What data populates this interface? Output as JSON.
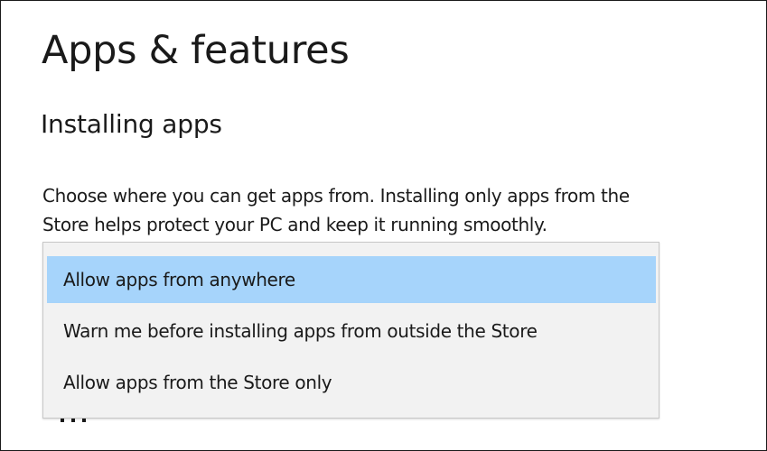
{
  "page": {
    "title": "Apps & features"
  },
  "section": {
    "heading": "Installing apps",
    "description_line1": "Choose where you can get apps from. Installing only apps from the",
    "description_line2": "Store helps protect your PC and keep it running smoothly."
  },
  "dropdown": {
    "selected_index": 0,
    "highlight_color": "#a6d4fb",
    "list_background": "#f2f2f2",
    "options": [
      {
        "label": "Allow apps from anywhere"
      },
      {
        "label": "Warn me before installing apps from outside the Store"
      },
      {
        "label": "Allow apps from the Store only"
      }
    ]
  }
}
